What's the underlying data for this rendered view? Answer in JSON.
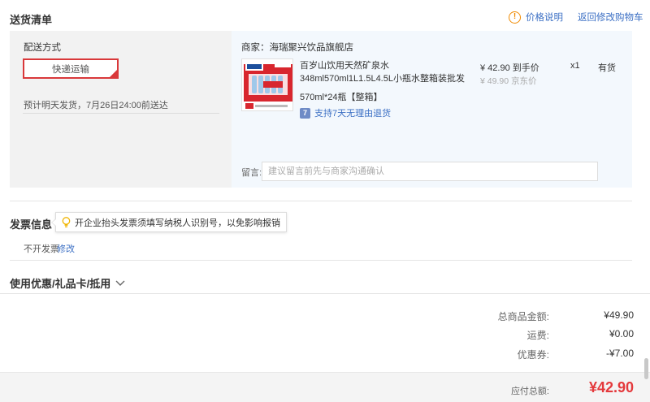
{
  "header": {
    "title": "送货清单",
    "price_help": "价格说明",
    "back_to_cart": "返回修改购物车",
    "warn_glyph": "!"
  },
  "shipping": {
    "label": "配送方式",
    "method": "快递运输",
    "eta": "预计明天发货，7月26日24:00前送达"
  },
  "merchant": {
    "name": "商家：海瑞聚兴饮品旗舰店",
    "product": {
      "title_line1": "百岁山饮用天然矿泉水",
      "title_line2": "348ml570ml1L1.5L4.5L小瓶水整箱装批发",
      "spec": "570ml*24瓶【整箱】",
      "return_icon_glyph": "7",
      "return_policy": "支持7天无理由退货",
      "price": "¥ 42.90 到手价",
      "jd_price": "¥ 49.90 京东价",
      "qty": "x1",
      "stock": "有货",
      "image_icon": "water-bottle-pack-image"
    },
    "message_label": "留言:",
    "message_placeholder": "建议留言前先与商家沟通确认"
  },
  "invoice": {
    "title": "发票信息",
    "tip": "开企业抬头发票须填写纳税人识别号，以免影响报销",
    "status": "不开发票",
    "modify": "修改"
  },
  "coupons": {
    "title": "使用优惠/礼品卡/抵用"
  },
  "summary": {
    "rows": [
      {
        "label": "总商品金额:",
        "value": "¥49.90"
      },
      {
        "label": "运费:",
        "value": "¥0.00"
      },
      {
        "label": "优惠券:",
        "value": "-¥7.00"
      }
    ],
    "total_label": "应付总额:",
    "total_value": "¥42.90"
  },
  "colors": {
    "accent_red": "#e4393c",
    "link_blue": "#3b6fc4",
    "warning_orange": "#f08a00"
  }
}
